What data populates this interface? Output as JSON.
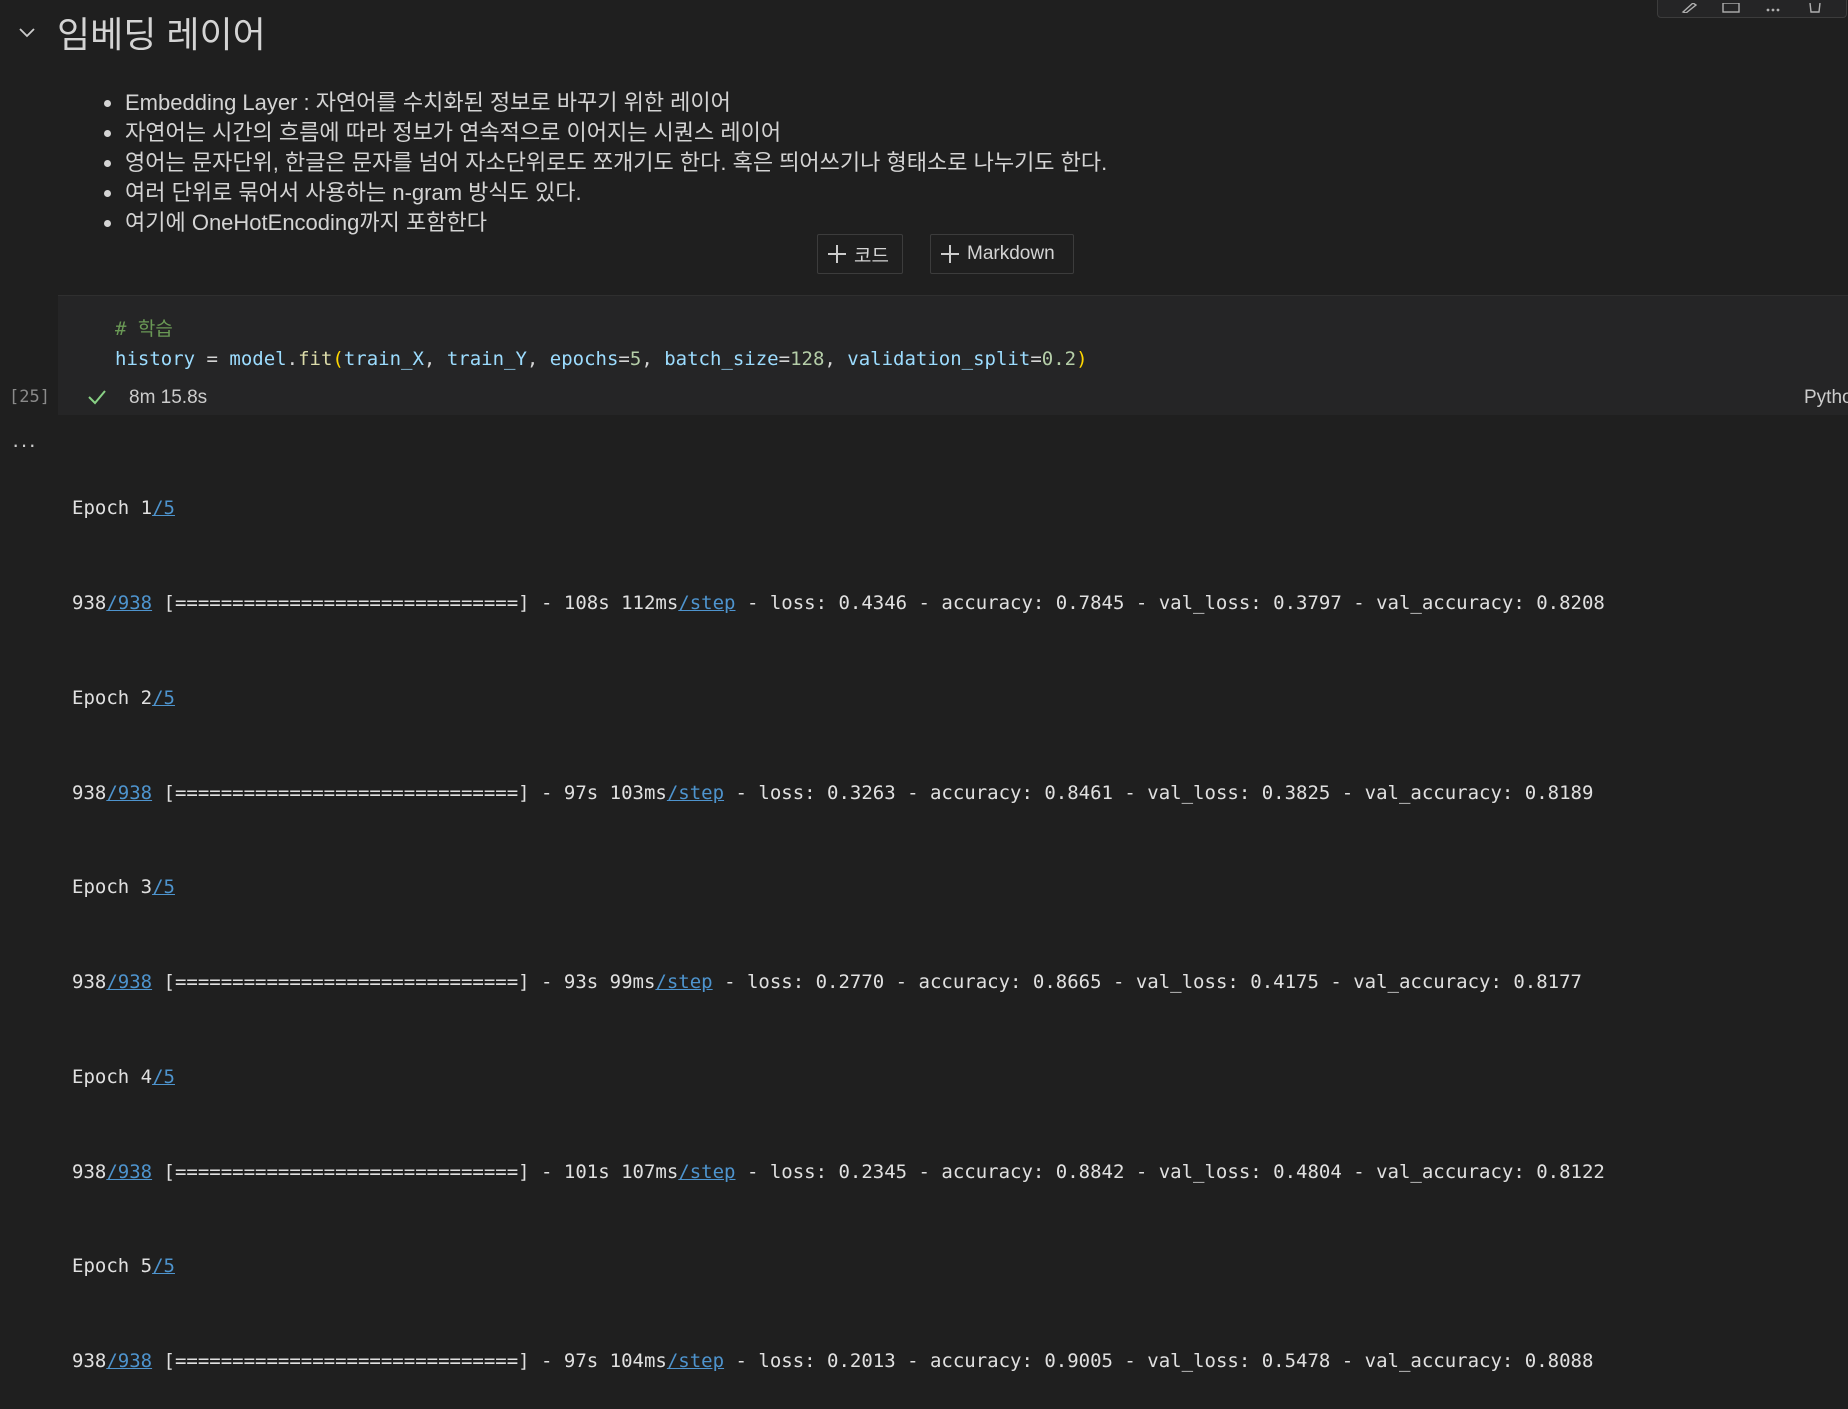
{
  "section": {
    "title": "임베딩 레이어",
    "bullets": [
      "Embedding Layer : 자연어를 수치화된 정보로 바꾸기 위한 레이어",
      "자연어는 시간의 흐름에 따라 정보가 연속적으로 이어지는 시퀀스 레이어",
      "영어는 문자단위, 한글은 문자를 넘어 자소단위로도 쪼개기도 한다. 혹은 띄어쓰기나 형태소로 나누기도 한다.",
      "여러 단위로 묶어서 사용하는 n-gram 방식도 있다.",
      "여기에 OneHotEncoding까지 포함한다"
    ]
  },
  "insert": {
    "code_label": "코드",
    "markdown_label": "Markdown"
  },
  "cell": {
    "comment": "# 학습",
    "code": {
      "var": "history",
      "eq": " = ",
      "obj": "model",
      "dot": ".",
      "func": "fit",
      "open": "(",
      "arg1": "train_X",
      "comma": ", ",
      "arg2": "train_Y",
      "kw1": "epochs",
      "v1": "5",
      "kw2": "batch_size",
      "v2": "128",
      "kw3": "validation_split",
      "v3": "0.2",
      "close": ")"
    },
    "execution_count": "[25]",
    "exec_time": "8m 15.8s",
    "language": "Python"
  },
  "output": {
    "more_label": "···",
    "epochs": [
      {
        "prefix": "Epoch 1",
        "link": "/5",
        "count": "938",
        "total": "/938",
        "bar": " [==============================] - 108s 112ms",
        "step": "/step",
        "metrics": " - loss: 0.4346 - accuracy: 0.7845 - val_loss: 0.3797 - val_accuracy: 0.8208"
      },
      {
        "prefix": "Epoch 2",
        "link": "/5",
        "count": "938",
        "total": "/938",
        "bar": " [==============================] - 97s 103ms",
        "step": "/step",
        "metrics": " - loss: 0.3263 - accuracy: 0.8461 - val_loss: 0.3825 - val_accuracy: 0.8189"
      },
      {
        "prefix": "Epoch 3",
        "link": "/5",
        "count": "938",
        "total": "/938",
        "bar": " [==============================] - 93s 99ms",
        "step": "/step",
        "metrics": " - loss: 0.2770 - accuracy: 0.8665 - val_loss: 0.4175 - val_accuracy: 0.8177"
      },
      {
        "prefix": "Epoch 4",
        "link": "/5",
        "count": "938",
        "total": "/938",
        "bar": " [==============================] - 101s 107ms",
        "step": "/step",
        "metrics": " - loss: 0.2345 - accuracy: 0.8842 - val_loss: 0.4804 - val_accuracy: 0.8122"
      },
      {
        "prefix": "Epoch 5",
        "link": "/5",
        "count": "938",
        "total": "/938",
        "bar": " [==============================] - 97s 104ms",
        "step": "/step",
        "metrics": " - loss: 0.2013 - accuracy: 0.9005 - val_loss: 0.5478 - val_accuracy: 0.8088"
      }
    ]
  },
  "colors": {
    "background": "#1f1f1f",
    "cell_background": "#252526",
    "link": "#4e94ce",
    "comment": "#6a9955",
    "success": "#89d185"
  }
}
